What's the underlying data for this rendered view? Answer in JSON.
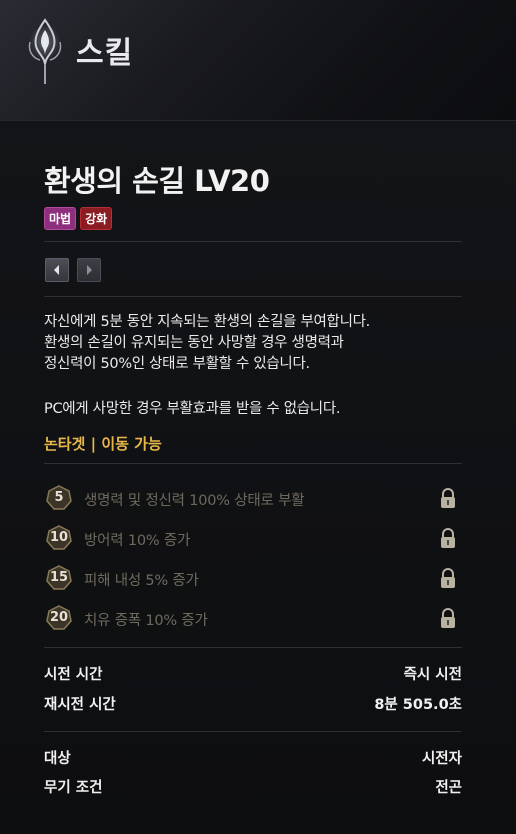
{
  "header": {
    "title": "스킬",
    "icon": "skill-emblem-icon"
  },
  "skill": {
    "name": "환생의 손길 LV20",
    "tags": [
      "마법",
      "강화"
    ],
    "description_lines": [
      "자신에게 5분 동안 지속되는 환생의 손길을 부여합니다.",
      "환생의 손길이 유지되는 동안 사망할 경우 생명력과",
      "정신력이 50%인 상태로 부활할 수 있습니다.",
      "PC에게 사망한 경우 부활효과를 받을 수 없습니다."
    ],
    "target_note": "논타겟 | 이동 가능"
  },
  "tiers": [
    {
      "level": "5",
      "text": "생명력 및 정신력 100% 상태로 부활",
      "locked": true
    },
    {
      "level": "10",
      "text": "방어력 10% 증가",
      "locked": true
    },
    {
      "level": "15",
      "text": "피해 내성 5% 증가",
      "locked": true
    },
    {
      "level": "20",
      "text": "치유 증폭 10% 증가",
      "locked": true
    }
  ],
  "stats": {
    "cast_time_label": "시전 시간",
    "cast_time_value": "즉시 시전",
    "cooldown_label": "재시전 시간",
    "cooldown_value": "8분 505.0초",
    "target_label": "대상",
    "target_value": "시전자",
    "weapon_label": "무기 조건",
    "weapon_value": "전곤"
  },
  "colors": {
    "accent_gold": "#e8b84a",
    "tag_magic": "#8d2f7c",
    "tag_enhance": "#8a1c22",
    "locked_text": "#6e6a5e"
  }
}
